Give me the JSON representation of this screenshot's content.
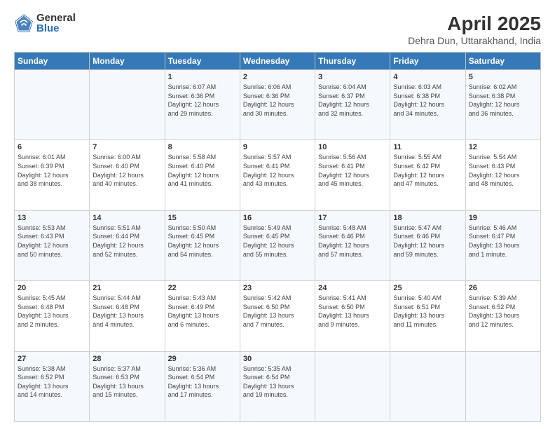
{
  "header": {
    "logo_general": "General",
    "logo_blue": "Blue",
    "title": "April 2025",
    "subtitle": "Dehra Dun, Uttarakhand, India"
  },
  "days_of_week": [
    "Sunday",
    "Monday",
    "Tuesday",
    "Wednesday",
    "Thursday",
    "Friday",
    "Saturday"
  ],
  "weeks": [
    [
      {
        "day": "",
        "info": ""
      },
      {
        "day": "",
        "info": ""
      },
      {
        "day": "1",
        "info": "Sunrise: 6:07 AM\nSunset: 6:36 PM\nDaylight: 12 hours\nand 29 minutes."
      },
      {
        "day": "2",
        "info": "Sunrise: 6:06 AM\nSunset: 6:36 PM\nDaylight: 12 hours\nand 30 minutes."
      },
      {
        "day": "3",
        "info": "Sunrise: 6:04 AM\nSunset: 6:37 PM\nDaylight: 12 hours\nand 32 minutes."
      },
      {
        "day": "4",
        "info": "Sunrise: 6:03 AM\nSunset: 6:38 PM\nDaylight: 12 hours\nand 34 minutes."
      },
      {
        "day": "5",
        "info": "Sunrise: 6:02 AM\nSunset: 6:38 PM\nDaylight: 12 hours\nand 36 minutes."
      }
    ],
    [
      {
        "day": "6",
        "info": "Sunrise: 6:01 AM\nSunset: 6:39 PM\nDaylight: 12 hours\nand 38 minutes."
      },
      {
        "day": "7",
        "info": "Sunrise: 6:00 AM\nSunset: 6:40 PM\nDaylight: 12 hours\nand 40 minutes."
      },
      {
        "day": "8",
        "info": "Sunrise: 5:58 AM\nSunset: 6:40 PM\nDaylight: 12 hours\nand 41 minutes."
      },
      {
        "day": "9",
        "info": "Sunrise: 5:57 AM\nSunset: 6:41 PM\nDaylight: 12 hours\nand 43 minutes."
      },
      {
        "day": "10",
        "info": "Sunrise: 5:56 AM\nSunset: 6:41 PM\nDaylight: 12 hours\nand 45 minutes."
      },
      {
        "day": "11",
        "info": "Sunrise: 5:55 AM\nSunset: 6:42 PM\nDaylight: 12 hours\nand 47 minutes."
      },
      {
        "day": "12",
        "info": "Sunrise: 5:54 AM\nSunset: 6:43 PM\nDaylight: 12 hours\nand 48 minutes."
      }
    ],
    [
      {
        "day": "13",
        "info": "Sunrise: 5:53 AM\nSunset: 6:43 PM\nDaylight: 12 hours\nand 50 minutes."
      },
      {
        "day": "14",
        "info": "Sunrise: 5:51 AM\nSunset: 6:44 PM\nDaylight: 12 hours\nand 52 minutes."
      },
      {
        "day": "15",
        "info": "Sunrise: 5:50 AM\nSunset: 6:45 PM\nDaylight: 12 hours\nand 54 minutes."
      },
      {
        "day": "16",
        "info": "Sunrise: 5:49 AM\nSunset: 6:45 PM\nDaylight: 12 hours\nand 55 minutes."
      },
      {
        "day": "17",
        "info": "Sunrise: 5:48 AM\nSunset: 6:46 PM\nDaylight: 12 hours\nand 57 minutes."
      },
      {
        "day": "18",
        "info": "Sunrise: 5:47 AM\nSunset: 6:46 PM\nDaylight: 12 hours\nand 59 minutes."
      },
      {
        "day": "19",
        "info": "Sunrise: 5:46 AM\nSunset: 6:47 PM\nDaylight: 13 hours\nand 1 minute."
      }
    ],
    [
      {
        "day": "20",
        "info": "Sunrise: 5:45 AM\nSunset: 6:48 PM\nDaylight: 13 hours\nand 2 minutes."
      },
      {
        "day": "21",
        "info": "Sunrise: 5:44 AM\nSunset: 6:48 PM\nDaylight: 13 hours\nand 4 minutes."
      },
      {
        "day": "22",
        "info": "Sunrise: 5:43 AM\nSunset: 6:49 PM\nDaylight: 13 hours\nand 6 minutes."
      },
      {
        "day": "23",
        "info": "Sunrise: 5:42 AM\nSunset: 6:50 PM\nDaylight: 13 hours\nand 7 minutes."
      },
      {
        "day": "24",
        "info": "Sunrise: 5:41 AM\nSunset: 6:50 PM\nDaylight: 13 hours\nand 9 minutes."
      },
      {
        "day": "25",
        "info": "Sunrise: 5:40 AM\nSunset: 6:51 PM\nDaylight: 13 hours\nand 11 minutes."
      },
      {
        "day": "26",
        "info": "Sunrise: 5:39 AM\nSunset: 6:52 PM\nDaylight: 13 hours\nand 12 minutes."
      }
    ],
    [
      {
        "day": "27",
        "info": "Sunrise: 5:38 AM\nSunset: 6:52 PM\nDaylight: 13 hours\nand 14 minutes."
      },
      {
        "day": "28",
        "info": "Sunrise: 5:37 AM\nSunset: 6:53 PM\nDaylight: 13 hours\nand 15 minutes."
      },
      {
        "day": "29",
        "info": "Sunrise: 5:36 AM\nSunset: 6:54 PM\nDaylight: 13 hours\nand 17 minutes."
      },
      {
        "day": "30",
        "info": "Sunrise: 5:35 AM\nSunset: 6:54 PM\nDaylight: 13 hours\nand 19 minutes."
      },
      {
        "day": "",
        "info": ""
      },
      {
        "day": "",
        "info": ""
      },
      {
        "day": "",
        "info": ""
      }
    ]
  ]
}
